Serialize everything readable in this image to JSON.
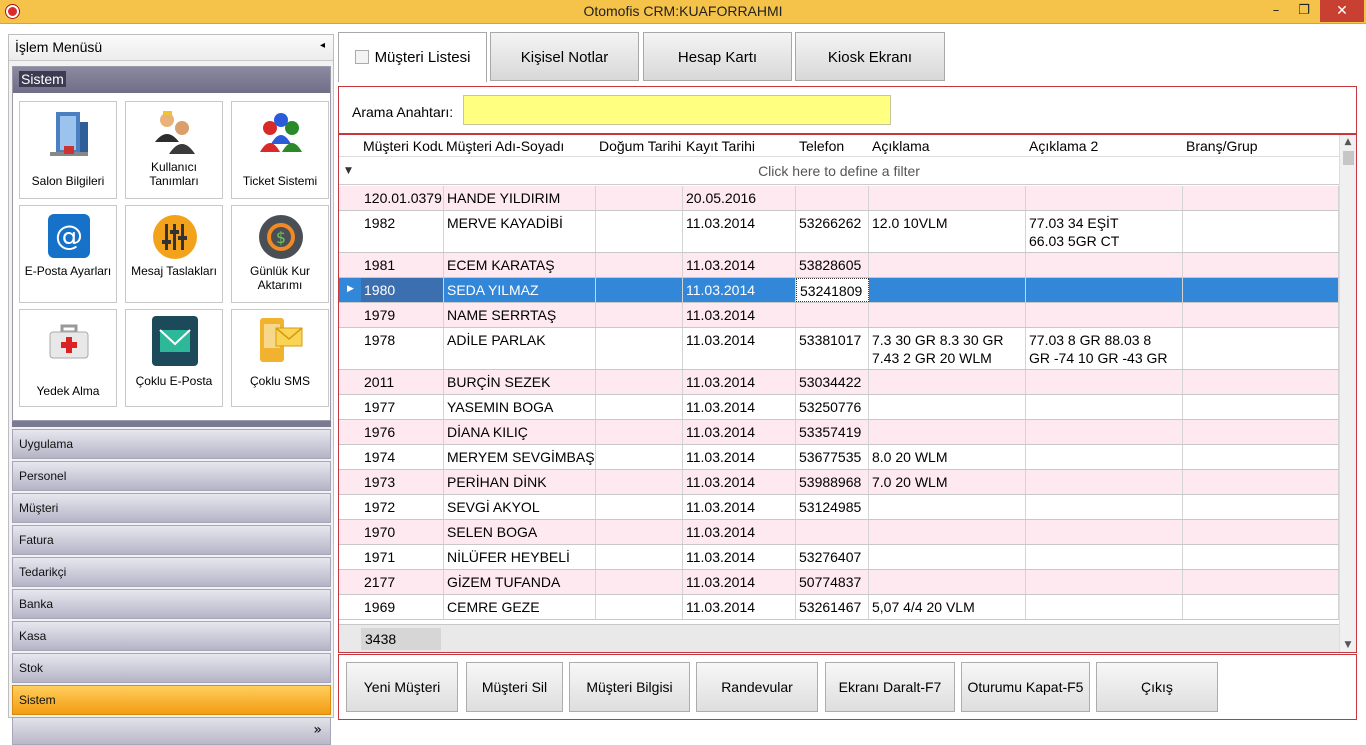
{
  "window": {
    "title": "Otomofis CRM:KUAFORRAHMI",
    "minimize": "–",
    "maximize": "❐",
    "close": "✕"
  },
  "sidebar": {
    "header": "İşlem Menüsü",
    "collapse_icon": "◂",
    "group_title": "Sistem",
    "tiles": [
      {
        "label": "Salon Bilgileri",
        "icon": "building-icon"
      },
      {
        "label": "Kullanıcı Tanımları",
        "icon": "users-icon"
      },
      {
        "label": "Ticket Sistemi",
        "icon": "people-ticket-icon"
      },
      {
        "label": "E-Posta Ayarları",
        "icon": "at-sign-icon"
      },
      {
        "label": "Mesaj Taslakları",
        "icon": "sliders-icon"
      },
      {
        "label": "Günlük Kur Aktarımı",
        "icon": "currency-exchange-icon"
      },
      {
        "label": "Yedek Alma",
        "icon": "first-aid-kit-icon"
      },
      {
        "label": "Çoklu E-Posta",
        "icon": "envelope-icon"
      },
      {
        "label": "Çoklu SMS",
        "icon": "sms-icon"
      }
    ],
    "nav_items": [
      "Uygulama",
      "Personel",
      "Müşteri",
      "Fatura",
      "Tedarikçi",
      "Banka",
      "Kasa",
      "Stok",
      "Sistem"
    ],
    "active_nav": "Sistem",
    "more_icon": "»"
  },
  "tabs": [
    {
      "label": "Müşteri Listesi",
      "active": true
    },
    {
      "label": "Kişisel Notlar",
      "active": false
    },
    {
      "label": "Hesap Kartı",
      "active": false
    },
    {
      "label": "Kiosk Ekranı",
      "active": false
    }
  ],
  "search": {
    "label": "Arama Anahtarı:",
    "value": ""
  },
  "grid": {
    "columns": [
      "Müşteri Kodu",
      "Müşteri Adı-Soyadı",
      "Doğum Tarihi",
      "Kayıt Tarihi",
      "Telefon",
      "Açıklama",
      "Açıklama 2",
      "Branş/Grup"
    ],
    "filter_text": "Click here to define a filter",
    "rows": [
      {
        "code": "120.01.0379",
        "name": "HANDE YILDIRIM",
        "birth": "",
        "reg": "20.05.2016",
        "phone": "",
        "desc": "",
        "desc2": "",
        "group": ""
      },
      {
        "code": "1982",
        "name": "MERVE KAYADİBİ",
        "birth": "",
        "reg": "11.03.2014",
        "phone": "53266262",
        "desc": "12.0  10VLM",
        "desc2": "77.03    34   EŞİT\n66.03  5GR  CT",
        "group": ""
      },
      {
        "code": "1981",
        "name": "ECEM KARATAŞ",
        "birth": "",
        "reg": "11.03.2014",
        "phone": "53828605",
        "desc": "",
        "desc2": "",
        "group": ""
      },
      {
        "code": "1980",
        "name": "SEDA YILMAZ",
        "birth": "",
        "reg": "11.03.2014",
        "phone": "53241809",
        "desc": "",
        "desc2": "",
        "group": ""
      },
      {
        "code": "1979",
        "name": "NAME SERRTAŞ",
        "birth": "",
        "reg": "11.03.2014",
        "phone": "",
        "desc": "",
        "desc2": "",
        "group": ""
      },
      {
        "code": "1978",
        "name": "ADİLE PARLAK",
        "birth": "",
        "reg": "11.03.2014",
        "phone": "53381017",
        "desc": "7.3 30 GR 8.3 30 GR\n7.43 2 GR 20 WLM",
        "desc2": "77.03 8 GR 88.03 8\nGR -74 10 GR -43 GR",
        "group": ""
      },
      {
        "code": "2011",
        "name": "BURÇİN SEZEK",
        "birth": "",
        "reg": "11.03.2014",
        "phone": "53034422",
        "desc": "",
        "desc2": "",
        "group": ""
      },
      {
        "code": "1977",
        "name": "YASEMIN BOGA",
        "birth": "",
        "reg": "11.03.2014",
        "phone": "53250776",
        "desc": "",
        "desc2": "",
        "group": ""
      },
      {
        "code": "1976",
        "name": "DİANA KILIÇ",
        "birth": "",
        "reg": "11.03.2014",
        "phone": "53357419",
        "desc": "",
        "desc2": "",
        "group": ""
      },
      {
        "code": "1974",
        "name": "MERYEM SEVGİMBAŞ",
        "birth": "",
        "reg": "11.03.2014",
        "phone": "53677535",
        "desc": "8.0 20 WLM",
        "desc2": "",
        "group": ""
      },
      {
        "code": "1973",
        "name": "PERİHAN DİNK",
        "birth": "",
        "reg": "11.03.2014",
        "phone": "53988968",
        "desc": "7.0 20 WLM",
        "desc2": "",
        "group": ""
      },
      {
        "code": "1972",
        "name": "SEVGİ AKYOL",
        "birth": "",
        "reg": "11.03.2014",
        "phone": "53124985",
        "desc": "",
        "desc2": "",
        "group": ""
      },
      {
        "code": "1970",
        "name": "SELEN BOGA",
        "birth": "",
        "reg": "11.03.2014",
        "phone": "",
        "desc": "",
        "desc2": "",
        "group": ""
      },
      {
        "code": "1971",
        "name": "NİLÜFER HEYBELİ",
        "birth": "",
        "reg": "11.03.2014",
        "phone": "53276407",
        "desc": "",
        "desc2": "",
        "group": ""
      },
      {
        "code": "2177",
        "name": "GİZEM TUFANDA",
        "birth": "",
        "reg": "11.03.2014",
        "phone": "50774837",
        "desc": "",
        "desc2": "",
        "group": ""
      },
      {
        "code": "1969",
        "name": "CEMRE GEZE",
        "birth": "",
        "reg": "11.03.2014",
        "phone": "53261467",
        "desc": "5,07    4/4     20  VLM",
        "desc2": "",
        "group": ""
      }
    ],
    "selected_index": 3,
    "record_count": "3438"
  },
  "actions": [
    "Yeni Müşteri",
    "Müşteri Sil",
    "Müşteri Bilgisi",
    "Randevular",
    "Ekranı Daralt-F7",
    "Oturumu Kapat-F5",
    "Çıkış"
  ],
  "colors": {
    "titlebar": "#f6c34a",
    "selection": "#3387d8",
    "alt_row": "#fde9ef",
    "search_bg": "#ffff80",
    "active_nav": "#f39c12",
    "panel_border": "#c2383e"
  }
}
